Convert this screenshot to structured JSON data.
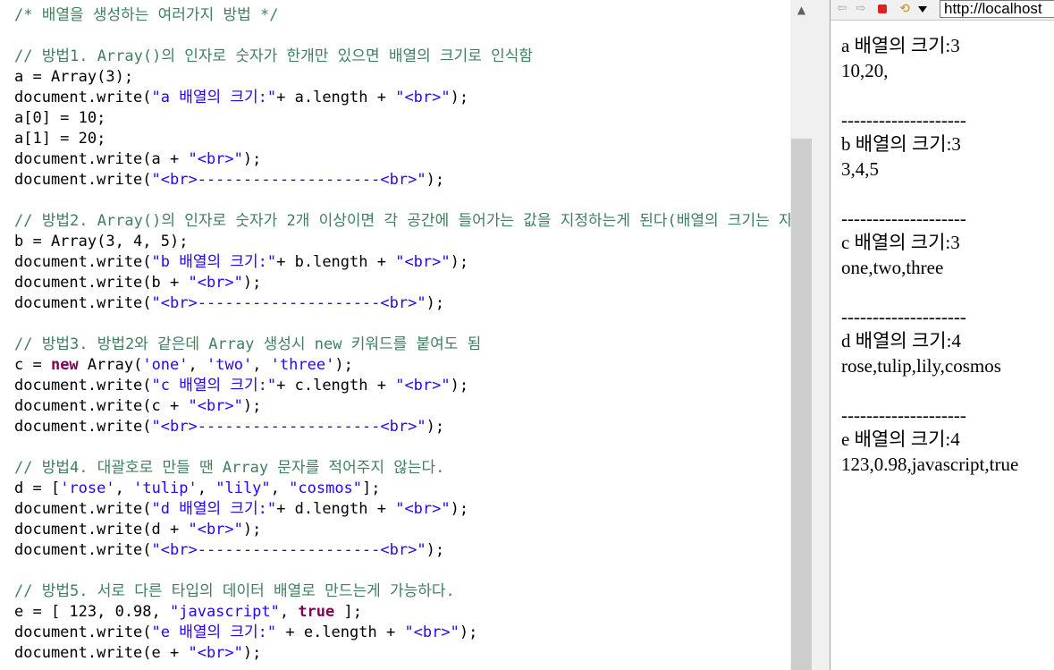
{
  "editor": {
    "lines": [
      [
        {
          "t": "/* 배열을 생성하는 여러가지 방법 */",
          "k": "comment"
        }
      ],
      [],
      [
        {
          "t": "// 방법1. Array()의 인자로 숫자가 한개만 있으면 배열의 크기로 인식함",
          "k": "comment"
        }
      ],
      [
        {
          "t": "a = Array(3);",
          "k": "plain"
        }
      ],
      [
        {
          "t": "document.write(",
          "k": "plain"
        },
        {
          "t": "\"a 배열의 크기:\"",
          "k": "string"
        },
        {
          "t": "+ a.length + ",
          "k": "plain"
        },
        {
          "t": "\"<br>\"",
          "k": "string"
        },
        {
          "t": ");",
          "k": "plain"
        }
      ],
      [
        {
          "t": "a[0] = 10;",
          "k": "plain"
        }
      ],
      [
        {
          "t": "a[1] = 20;",
          "k": "plain"
        }
      ],
      [
        {
          "t": "document.write(a + ",
          "k": "plain"
        },
        {
          "t": "\"<br>\"",
          "k": "string"
        },
        {
          "t": ");",
          "k": "plain"
        }
      ],
      [
        {
          "t": "document.write(",
          "k": "plain"
        },
        {
          "t": "\"<br>--------------------<br>\"",
          "k": "string"
        },
        {
          "t": ");",
          "k": "plain"
        }
      ],
      [],
      [
        {
          "t": "// 방법2. Array()의 인자로 숫자가 2개 이상이면 각 공간에 들어가는 값을 지정하는게 된다(배열의 크기는 자",
          "k": "comment"
        }
      ],
      [
        {
          "t": "b = Array(3, 4, 5);",
          "k": "plain"
        }
      ],
      [
        {
          "t": "document.write(",
          "k": "plain"
        },
        {
          "t": "\"b 배열의 크기:\"",
          "k": "string"
        },
        {
          "t": "+ b.length + ",
          "k": "plain"
        },
        {
          "t": "\"<br>\"",
          "k": "string"
        },
        {
          "t": ");",
          "k": "plain"
        }
      ],
      [
        {
          "t": "document.write(b + ",
          "k": "plain"
        },
        {
          "t": "\"<br>\"",
          "k": "string"
        },
        {
          "t": ");",
          "k": "plain"
        }
      ],
      [
        {
          "t": "document.write(",
          "k": "plain"
        },
        {
          "t": "\"<br>--------------------<br>\"",
          "k": "string"
        },
        {
          "t": ");",
          "k": "plain"
        }
      ],
      [],
      [
        {
          "t": "// 방법3. 방법2와 같은데 Array 생성시 new 키워드를 붙여도 됨",
          "k": "comment"
        }
      ],
      [
        {
          "t": "c = ",
          "k": "plain"
        },
        {
          "t": "new",
          "k": "keyword"
        },
        {
          "t": " Array(",
          "k": "plain"
        },
        {
          "t": "'one'",
          "k": "string"
        },
        {
          "t": ", ",
          "k": "plain"
        },
        {
          "t": "'two'",
          "k": "string"
        },
        {
          "t": ", ",
          "k": "plain"
        },
        {
          "t": "'three'",
          "k": "string"
        },
        {
          "t": ");",
          "k": "plain"
        }
      ],
      [
        {
          "t": "document.write(",
          "k": "plain"
        },
        {
          "t": "\"c 배열의 크기:\"",
          "k": "string"
        },
        {
          "t": "+ c.length + ",
          "k": "plain"
        },
        {
          "t": "\"<br>\"",
          "k": "string"
        },
        {
          "t": ");",
          "k": "plain"
        }
      ],
      [
        {
          "t": "document.write(c + ",
          "k": "plain"
        },
        {
          "t": "\"<br>\"",
          "k": "string"
        },
        {
          "t": ");",
          "k": "plain"
        }
      ],
      [
        {
          "t": "document.write(",
          "k": "plain"
        },
        {
          "t": "\"<br>--------------------<br>\"",
          "k": "string"
        },
        {
          "t": ");",
          "k": "plain"
        }
      ],
      [],
      [
        {
          "t": "// 방법4. 대괄호로 만들 땐 Array 문자를 적어주지 않는다.",
          "k": "comment"
        }
      ],
      [
        {
          "t": "d = [",
          "k": "plain"
        },
        {
          "t": "'rose'",
          "k": "string"
        },
        {
          "t": ", ",
          "k": "plain"
        },
        {
          "t": "'tulip'",
          "k": "string"
        },
        {
          "t": ", ",
          "k": "plain"
        },
        {
          "t": "\"lily\"",
          "k": "string"
        },
        {
          "t": ", ",
          "k": "plain"
        },
        {
          "t": "\"cosmos\"",
          "k": "string"
        },
        {
          "t": "];",
          "k": "plain"
        }
      ],
      [
        {
          "t": "document.write(",
          "k": "plain"
        },
        {
          "t": "\"d 배열의 크기:\"",
          "k": "string"
        },
        {
          "t": "+ d.length + ",
          "k": "plain"
        },
        {
          "t": "\"<br>\"",
          "k": "string"
        },
        {
          "t": ");",
          "k": "plain"
        }
      ],
      [
        {
          "t": "document.write(d + ",
          "k": "plain"
        },
        {
          "t": "\"<br>\"",
          "k": "string"
        },
        {
          "t": ");",
          "k": "plain"
        }
      ],
      [
        {
          "t": "document.write(",
          "k": "plain"
        },
        {
          "t": "\"<br>--------------------<br>\"",
          "k": "string"
        },
        {
          "t": ");",
          "k": "plain"
        }
      ],
      [],
      [
        {
          "t": "// 방법5. 서로 다른 타입의 데이터 배열로 만드는게 가능하다.",
          "k": "comment"
        }
      ],
      [
        {
          "t": "e = [ 123, 0.98, ",
          "k": "plain"
        },
        {
          "t": "\"javascript\"",
          "k": "string"
        },
        {
          "t": ", ",
          "k": "plain"
        },
        {
          "t": "true",
          "k": "keyword"
        },
        {
          "t": " ];",
          "k": "plain"
        }
      ],
      [
        {
          "t": "document.write(",
          "k": "plain"
        },
        {
          "t": "\"e 배열의 크기:\"",
          "k": "string"
        },
        {
          "t": " + e.length + ",
          "k": "plain"
        },
        {
          "t": "\"<br>\"",
          "k": "string"
        },
        {
          "t": ");",
          "k": "plain"
        }
      ],
      [
        {
          "t": "document.write(e + ",
          "k": "plain"
        },
        {
          "t": "\"<br>\"",
          "k": "string"
        },
        {
          "t": ");",
          "k": "plain"
        }
      ]
    ]
  },
  "scrollbar": {
    "up_arrow": "▲"
  },
  "browser": {
    "toolbar": {
      "back_glyph": "⇦",
      "forward_glyph": "⇨",
      "refresh_glyph": "⟲",
      "icons": [
        "back-arrow-icon",
        "forward-arrow-icon",
        "stop-icon",
        "refresh-icon",
        "dropdown-arrow-icon"
      ]
    },
    "address": "http://localhost",
    "output_lines": [
      "a 배열의 크기:3",
      "10,20,",
      "",
      "--------------------",
      "b 배열의 크기:3",
      "3,4,5",
      "",
      "--------------------",
      "c 배열의 크기:3",
      "one,two,three",
      "",
      "--------------------",
      "d 배열의 크기:4",
      "rose,tulip,lily,cosmos",
      "",
      "--------------------",
      "e 배열의 크기:4",
      "123,0.98,javascript,true"
    ]
  },
  "colors": {
    "comment": "#3f7f5f",
    "string": "#2a00ff",
    "keyword": "#7f0055",
    "plain": "#000000",
    "stop_button": "#d9241f"
  }
}
